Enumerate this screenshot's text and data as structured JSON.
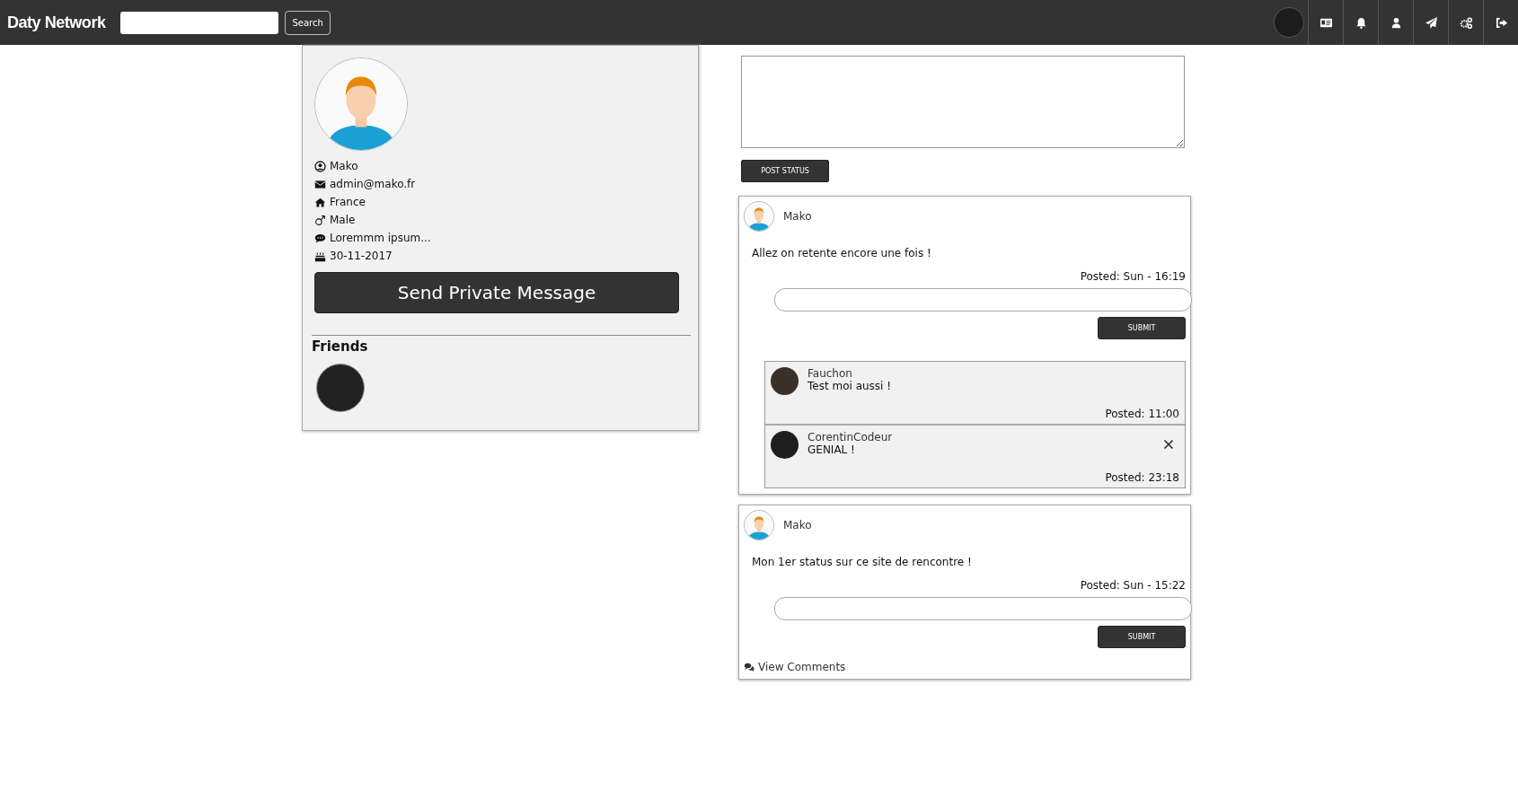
{
  "navbar": {
    "logo": "Daty Network",
    "search_button": "Search"
  },
  "profile": {
    "fields": [
      {
        "kind": "name",
        "text": "Mako"
      },
      {
        "kind": "email",
        "text": "admin@mako.fr"
      },
      {
        "kind": "home",
        "text": "France"
      },
      {
        "kind": "gender",
        "text": "Male"
      },
      {
        "kind": "bio",
        "text": "Loremmm ipsum..."
      },
      {
        "kind": "birthday",
        "text": "30-11-2017"
      }
    ],
    "message_button": "Send Private Message",
    "friends_title": "Friends",
    "friends": [
      {
        "kind": "photo"
      }
    ]
  },
  "composer": {
    "post_button": "POST STATUS"
  },
  "posts": [
    {
      "author": "Mako",
      "text": "Allez on retente encore une fois !",
      "posted": "Posted: Sun - 16:19",
      "submit_button": "SUBMIT",
      "comments": [
        {
          "author": "Fauchon",
          "text": "Test moi aussi !",
          "posted": "Posted: 11:00",
          "deletable": false
        },
        {
          "author": "CorentinCodeur",
          "text": "GENIAL !",
          "posted": "Posted: 23:18",
          "deletable": true
        }
      ]
    },
    {
      "author": "Mako",
      "text": "Mon 1er status sur ce site de rencontre !",
      "posted": "Posted: Sun - 15:22",
      "submit_button": "SUBMIT",
      "view_comments": "View Comments"
    }
  ]
}
